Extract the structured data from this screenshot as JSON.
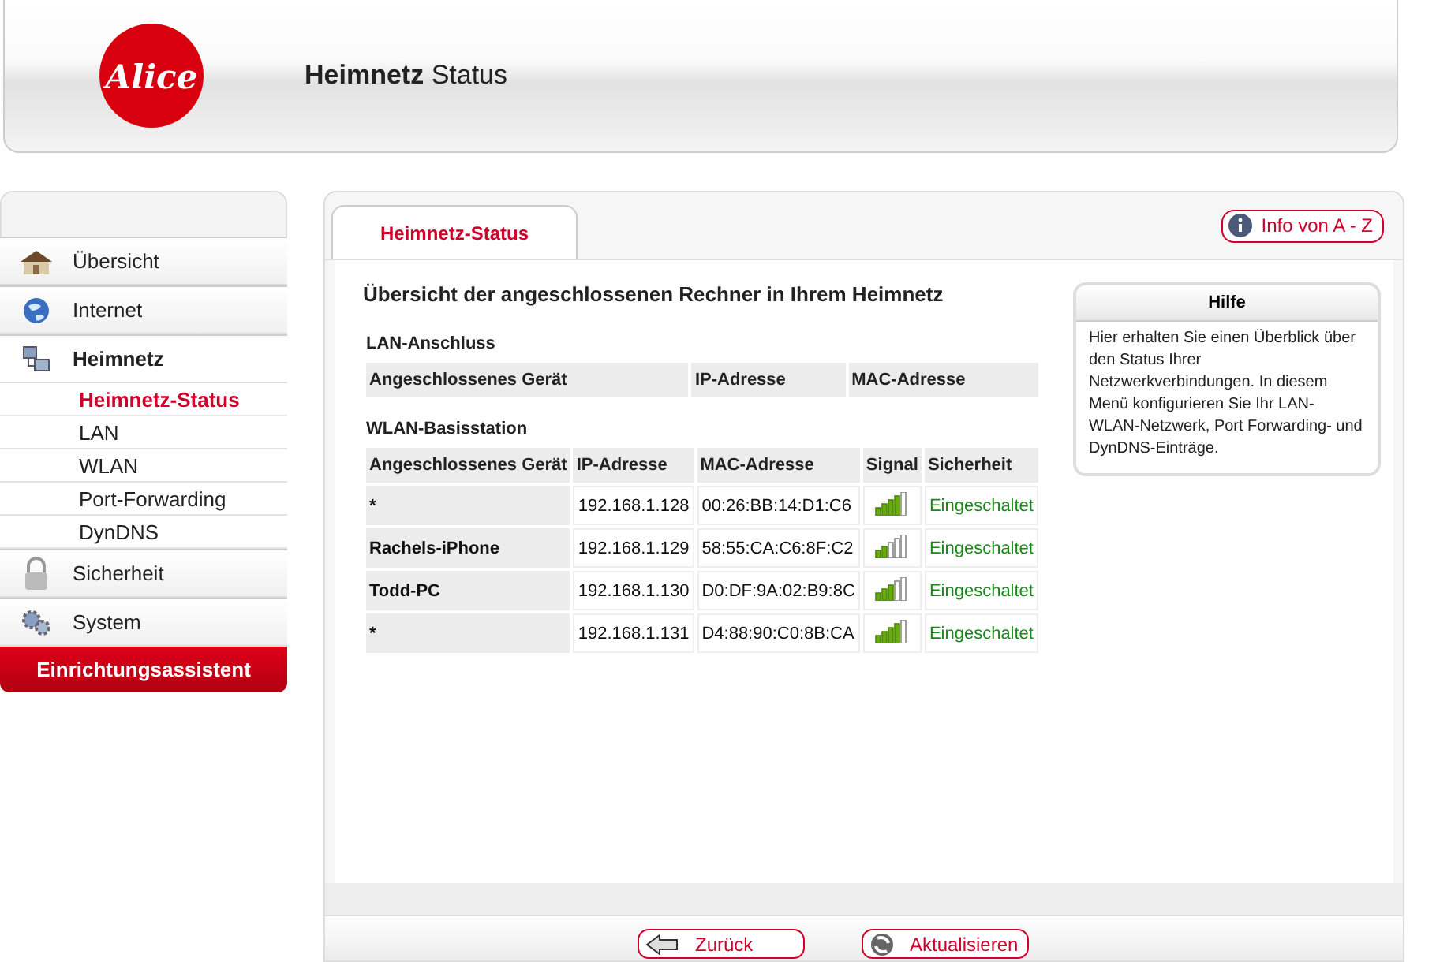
{
  "header": {
    "logo": "Alice",
    "title_bold": "Heimnetz",
    "title_rest": "Status"
  },
  "sidebar": {
    "items": [
      {
        "label": "Übersicht",
        "kind": "house",
        "selected": false
      },
      {
        "label": "Internet",
        "kind": "globe",
        "selected": false
      },
      {
        "label": "Heimnetz",
        "kind": "network",
        "selected": true,
        "children": [
          {
            "label": "Heimnetz-Status",
            "selected": true
          },
          {
            "label": "LAN",
            "selected": false
          },
          {
            "label": "WLAN",
            "selected": false
          },
          {
            "label": "Port-Forwarding",
            "selected": false
          },
          {
            "label": "DynDNS",
            "selected": false
          }
        ]
      },
      {
        "label": "Sicherheit",
        "kind": "lock",
        "selected": false
      },
      {
        "label": "System",
        "kind": "gears",
        "selected": false
      }
    ],
    "wizard": "Einrichtungsassistent"
  },
  "tabs": [
    {
      "label": "Heimnetz-Status",
      "selected": true
    }
  ],
  "info_button": "Info von A - Z",
  "heading": "Übersicht der angeschlossenen Rechner in Ihrem Heimnetz",
  "lan": {
    "title": "LAN-Anschluss",
    "columns": [
      "Angeschlossenes Gerät",
      "IP-Adresse",
      "MAC-Adresse"
    ]
  },
  "wlan": {
    "title": "WLAN-Basisstation",
    "columns": [
      "Angeschlossenes Gerät",
      "IP-Adresse",
      "MAC-Adresse",
      "Signal",
      "Sicherheit"
    ],
    "rows": [
      {
        "device": "*",
        "ip": "192.168.1.128",
        "mac": "00:26:BB:14:D1:C6",
        "signal": {
          "level": 0.8
        },
        "security": "Eingeschaltet"
      },
      {
        "device": "Rachels-iPhone",
        "ip": "192.168.1.129",
        "mac": "58:55:CA:C6:8F:C2",
        "signal": {
          "level": 0.4
        },
        "security": "Eingeschaltet"
      },
      {
        "device": "Todd-PC",
        "ip": "192.168.1.130",
        "mac": "D0:DF:9A:02:B9:8C",
        "signal": {
          "level": 0.6
        },
        "security": "Eingeschaltet"
      },
      {
        "device": "*",
        "ip": "192.168.1.131",
        "mac": "D4:88:90:C0:8B:CA",
        "signal": {
          "level": 0.8
        },
        "security": "Eingeschaltet"
      }
    ]
  },
  "help": {
    "title": "Hilfe",
    "text": "Hier erhalten Sie einen Überblick über den Status Ihrer Netzwerkverbindungen. In diesem Menü konfigurieren Sie Ihr LAN-WLAN-Netzwerk, Port Forwarding- und DynDNS-Einträge."
  },
  "buttons": [
    {
      "label": "Zurück",
      "kind": "back"
    },
    {
      "label": "Aktualisieren",
      "kind": "refresh"
    }
  ]
}
